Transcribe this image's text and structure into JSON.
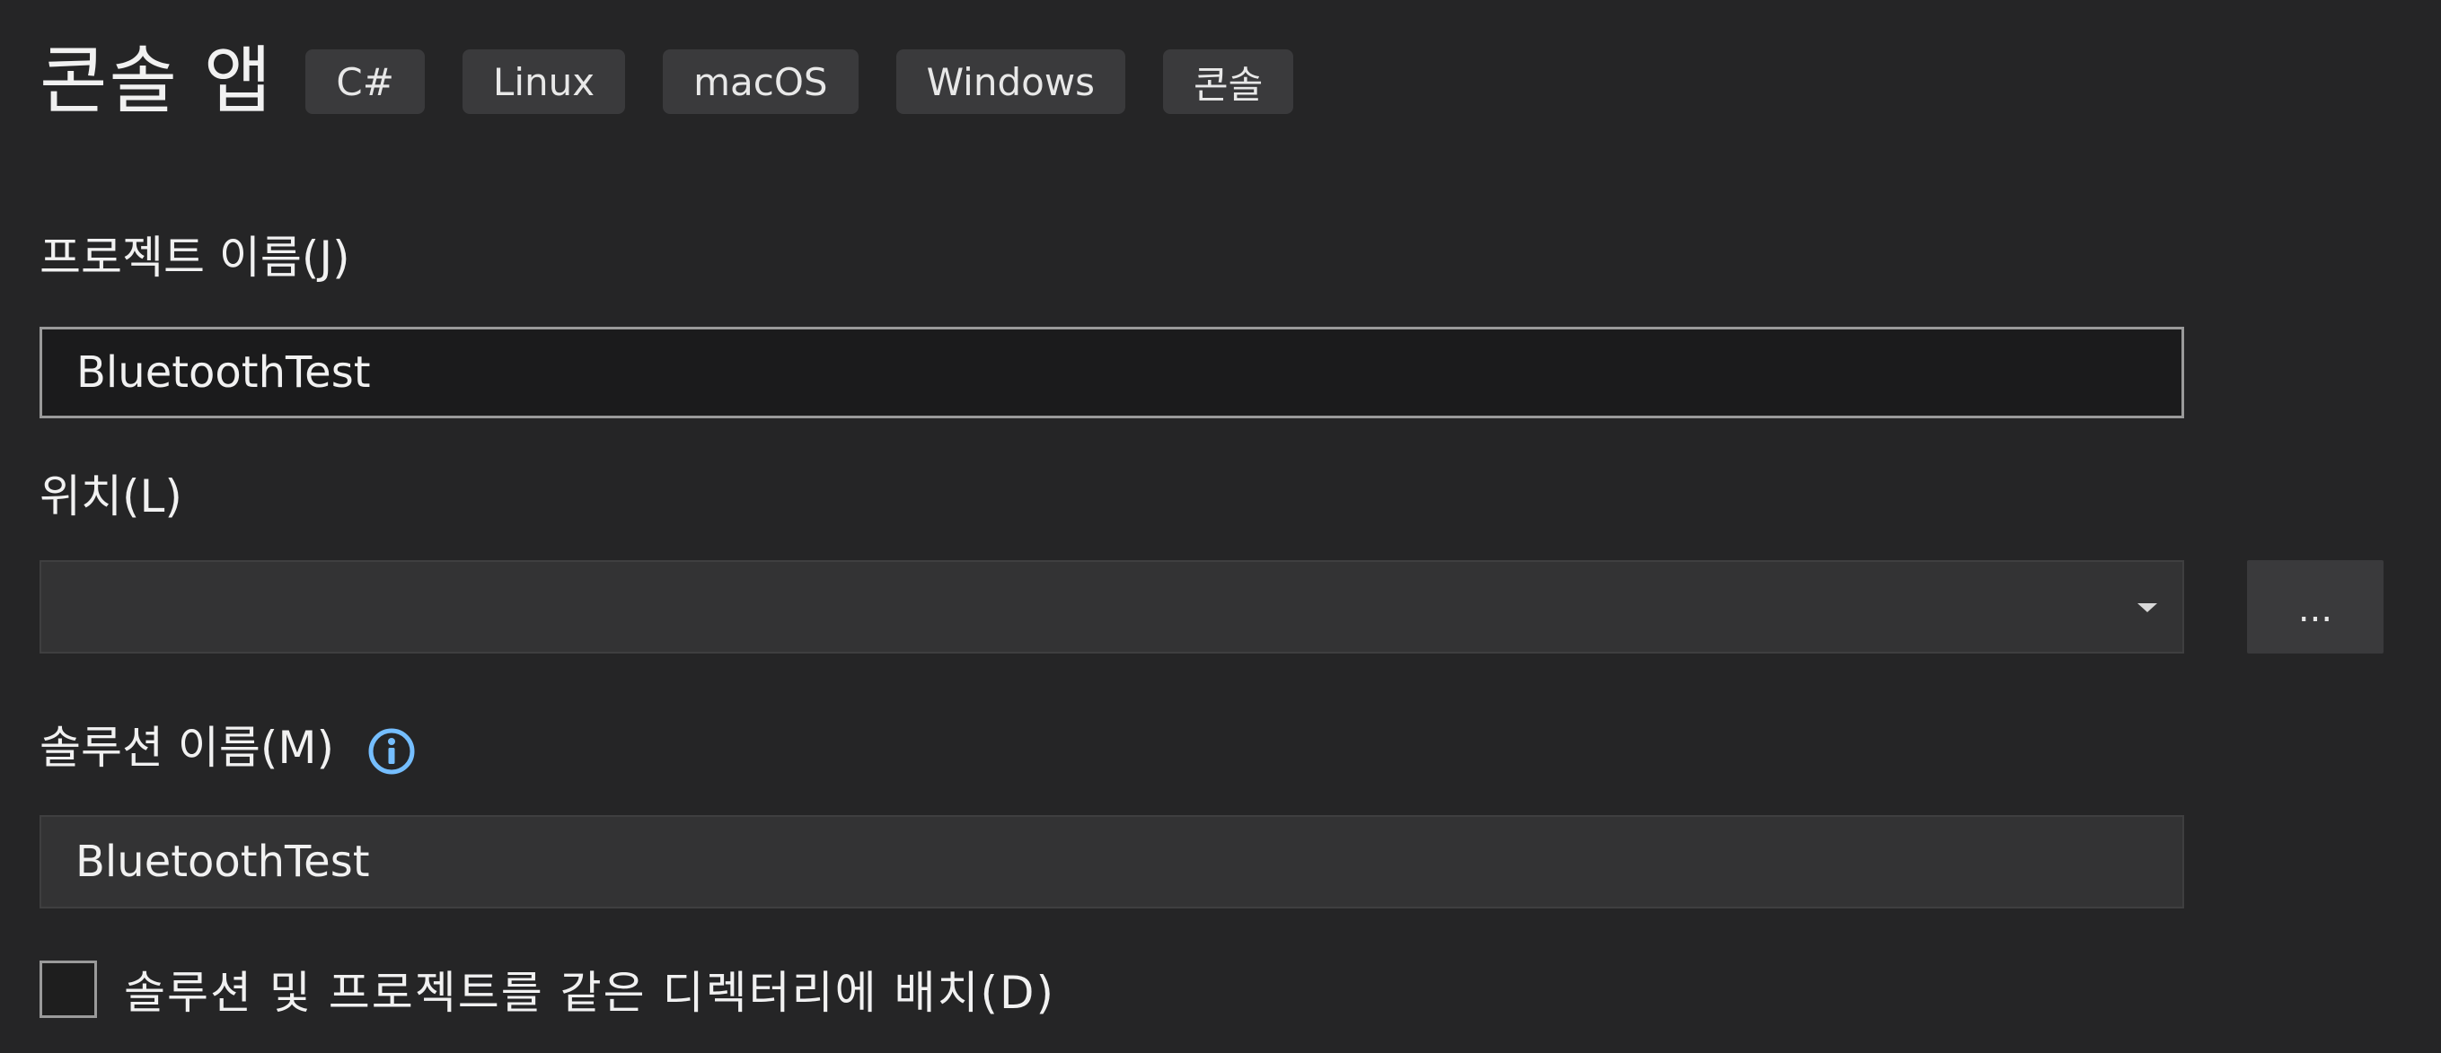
{
  "header": {
    "title": "콘솔 앱",
    "tags": [
      "C#",
      "Linux",
      "macOS",
      "Windows",
      "콘솔"
    ]
  },
  "project_name": {
    "label": "프로젝트 이름(J)",
    "value": "BluetoothTest"
  },
  "location": {
    "label": "위치(L)",
    "value": "",
    "browse_label": "..."
  },
  "solution_name": {
    "label": "솔루션 이름(M)",
    "value": "BluetoothTest",
    "info_icon": "info-icon"
  },
  "same_directory": {
    "label": "솔루션 및 프로젝트를 같은 디렉터리에 배치(D)",
    "checked": false
  },
  "colors": {
    "background": "#252526",
    "info_accent": "#75beff"
  }
}
